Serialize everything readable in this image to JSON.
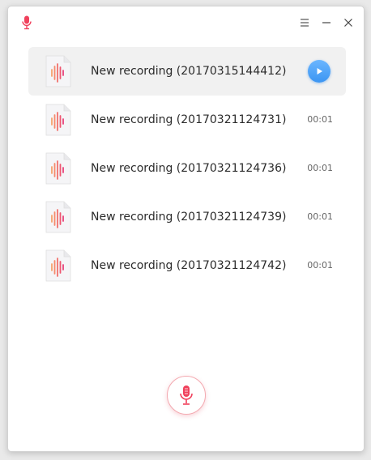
{
  "app": {
    "icon": "microphone-icon",
    "accent_color": "#f0415c"
  },
  "titlebar": {
    "menu_icon": "hamburger-menu-icon",
    "minimize_icon": "minimize-icon",
    "close_icon": "close-icon"
  },
  "recordings": [
    {
      "title": "New recording (20170315144412)",
      "duration": "",
      "selected": true
    },
    {
      "title": "New recording (20170321124731)",
      "duration": "00:01"
    },
    {
      "title": "New recording (20170321124736)",
      "duration": "00:01"
    },
    {
      "title": "New recording (20170321124739)",
      "duration": "00:01"
    },
    {
      "title": "New recording (20170321124742)",
      "duration": "00:01"
    }
  ],
  "play_button": {
    "icon": "play-icon",
    "color": "#3b95f2"
  },
  "record_button": {
    "icon": "microphone-icon",
    "color": "#f0415c"
  }
}
